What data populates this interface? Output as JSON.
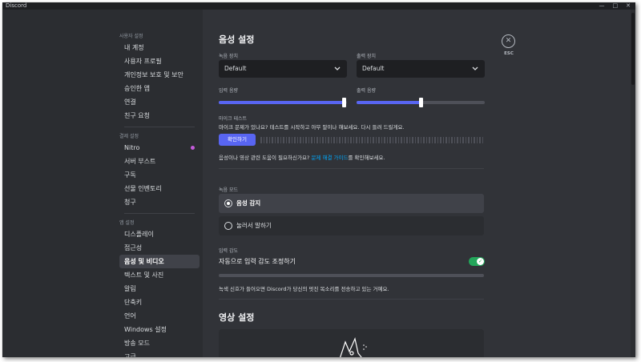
{
  "window": {
    "title": "Discord",
    "controls": [
      "—",
      "□",
      "✕"
    ]
  },
  "sidebar": {
    "sections": [
      {
        "header": "사용자 설정",
        "items": [
          "내 계정",
          "사용자 프로필",
          "개인정보 보호 및 보안",
          "승인한 앱",
          "연결",
          "친구 요청"
        ]
      },
      {
        "header": "결제 설정",
        "items": [
          "Nitro",
          "서버 부스트",
          "구독",
          "선물 인벤토리",
          "청구"
        ]
      },
      {
        "header": "앱 설정",
        "items": [
          "디스플레이",
          "접근성",
          "음성 및 비디오",
          "텍스트 및 사진",
          "알림",
          "단축키",
          "언어",
          "Windows 설정",
          "방송 모드",
          "고급"
        ]
      }
    ],
    "active_item": "음성 및 비디오"
  },
  "voice": {
    "title": "음성 설정",
    "input_device_label": "녹음 장치",
    "input_device_value": "Default",
    "output_device_label": "출력 장치",
    "output_device_value": "Default",
    "input_volume_label": "입력 음량",
    "output_volume_label": "출력 음량",
    "input_volume_level": 0.98,
    "output_volume_level": 0.5,
    "mic_test_label": "마이크 테스트",
    "mic_test_desc": "마이크 문제가 있나요? 테스트를 시작하고 아무 말이나 해보세요. 다시 들려 드릴게요.",
    "mic_test_button": "확인하기",
    "help_prefix": "음성이나 영상 관련 도움이 필요하신가요? ",
    "help_link": "문제 해결 가이드",
    "help_suffix": "를 확인해보세요.",
    "input_mode_label": "녹음 모드",
    "mode_voice": "음성 감지",
    "mode_ptt": "눌러서 말하기",
    "sensitivity_label": "입력 감도",
    "auto_sensitivity": "자동으로 입력 감도 조정하기",
    "sensitivity_note": "녹색 신호가 들어오면 Discord가 당신의 멋진 목소리를 전송하고 있는 거예요.",
    "toggle_check": "✓"
  },
  "video": {
    "title": "영상 설정"
  },
  "esc": {
    "icon": "✕",
    "label": "ESC"
  },
  "colors": {
    "accent": "#5865f2",
    "toggle": "#23a55a",
    "link": "#00a8fc",
    "nitro": "#c45bd9"
  }
}
